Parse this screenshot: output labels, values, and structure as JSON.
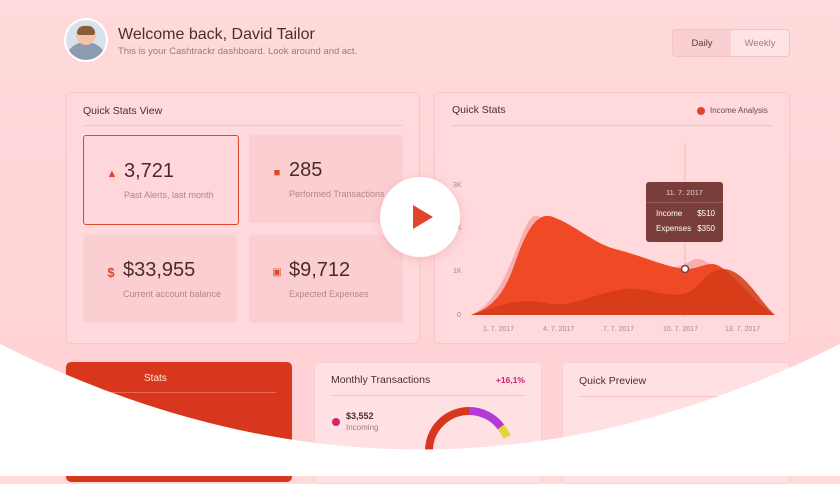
{
  "header": {
    "welcome": "Welcome back, David Tailor",
    "subtitle": "This is your Cashtrackr dashboard. Look around and act.",
    "toggle": [
      "Daily",
      "Weekly"
    ],
    "toggle_active": "Daily"
  },
  "quick_stats_view": {
    "title": "Quick Stats View",
    "cards": [
      {
        "icon": "bell-icon",
        "value": "3,721",
        "caption": "Past Alerts, last month"
      },
      {
        "icon": "briefcase-icon",
        "value": "285",
        "caption": "Performed Transactions"
      },
      {
        "icon": "dollar-icon",
        "value": "$33,955",
        "caption": "Current account balance"
      },
      {
        "icon": "banknote-icon",
        "value": "$9,712",
        "caption": "Expected Expenses"
      }
    ]
  },
  "quick_stats": {
    "title": "Quick Stats",
    "legend": "Income Analysis",
    "tooltip": {
      "date": "11. 7. 2017",
      "income_label": "Income",
      "income": "$510",
      "expenses_label": "Expenses",
      "expenses": "$350"
    }
  },
  "chart_data": {
    "type": "area",
    "x": [
      "1. 7. 2017",
      "4. 7. 2017",
      "7. 7. 2017",
      "10. 7. 2017",
      "13. 7. 2017"
    ],
    "yticks": [
      "0",
      "1K",
      "2K",
      "3K"
    ],
    "ylim": [
      0,
      3000
    ]
  },
  "bottom": {
    "stats_partial": "Stats",
    "monthly": {
      "title": "Monthly Transactions",
      "change": "+16,1%",
      "value": "$3,552",
      "label": "Incoming"
    },
    "preview": {
      "title": "Quick Preview"
    }
  },
  "video": {
    "icon": "play-icon"
  },
  "colors": {
    "accent": "#e0442a",
    "background": "#ffd6d8"
  }
}
